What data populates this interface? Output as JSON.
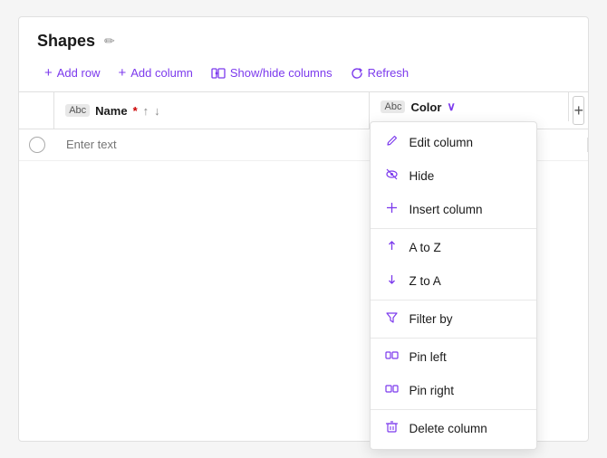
{
  "app": {
    "title": "Shapes",
    "edit_icon": "✏"
  },
  "toolbar": {
    "add_row": "Add row",
    "add_column": "Add column",
    "show_hide": "Show/hide columns",
    "refresh": "Refresh"
  },
  "table": {
    "columns": [
      {
        "type_badge": "Abc",
        "label": "Name",
        "required": true
      },
      {
        "type_badge": "Abc",
        "label": "Color"
      }
    ],
    "add_column_label": "+",
    "row": {
      "placeholder": "Enter text"
    }
  },
  "dropdown": {
    "items": [
      {
        "icon": "pencil",
        "label": "Edit column"
      },
      {
        "icon": "hide",
        "label": "Hide"
      },
      {
        "icon": "insert",
        "label": "Insert column"
      },
      {
        "separator": true
      },
      {
        "icon": "az",
        "label": "A to Z"
      },
      {
        "icon": "za",
        "label": "Z to A"
      },
      {
        "separator": true
      },
      {
        "icon": "filter",
        "label": "Filter by"
      },
      {
        "separator": true
      },
      {
        "icon": "pin-left",
        "label": "Pin left"
      },
      {
        "icon": "pin-right",
        "label": "Pin right"
      },
      {
        "separator": true
      },
      {
        "icon": "delete",
        "label": "Delete column"
      }
    ]
  }
}
